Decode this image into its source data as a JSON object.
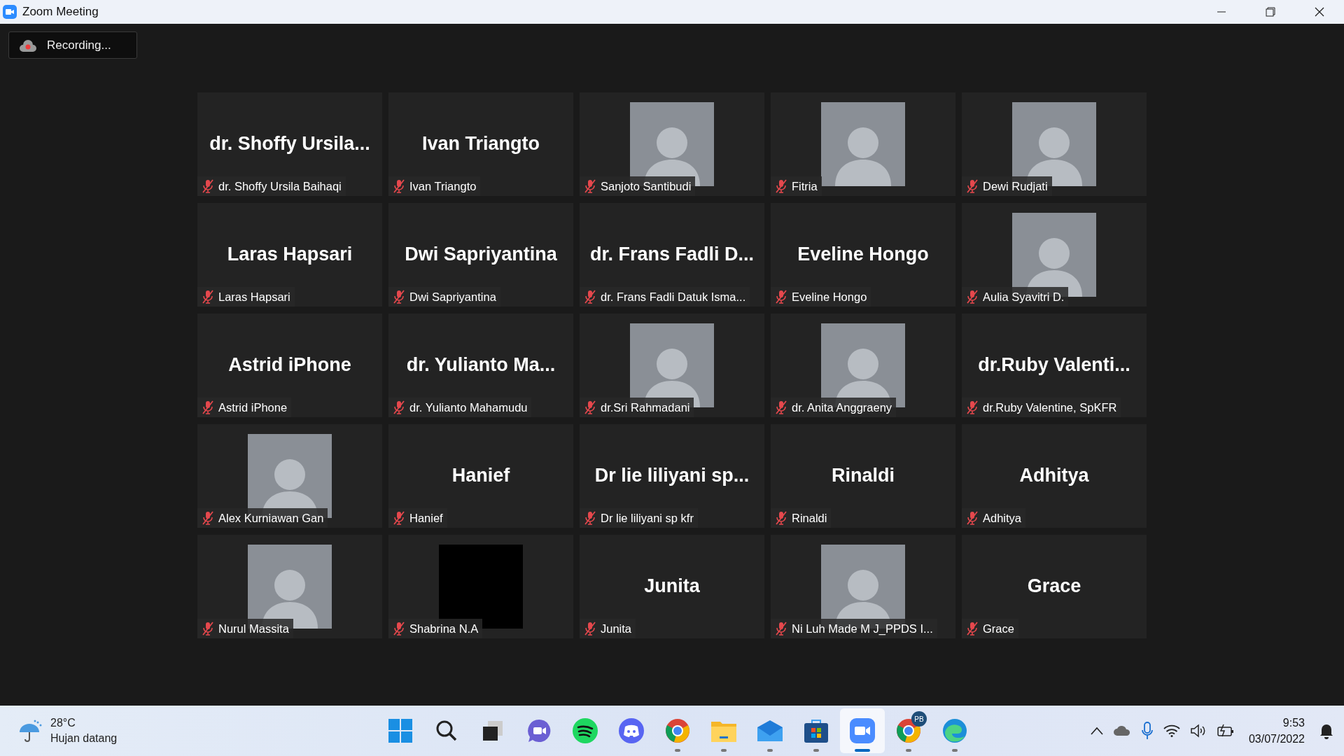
{
  "window": {
    "title": "Zoom Meeting"
  },
  "recording": {
    "label": "Recording..."
  },
  "tiles": [
    {
      "kind": "name",
      "display": "dr. Shoffy Ursila...",
      "name": "dr. Shoffy Ursila Baihaqi",
      "muted": true
    },
    {
      "kind": "name",
      "display": "Ivan Triangto",
      "name": "Ivan Triangto",
      "muted": true
    },
    {
      "kind": "photo",
      "name": "Sanjoto Santibudi",
      "muted": true
    },
    {
      "kind": "photo",
      "name": "Fitria",
      "muted": true
    },
    {
      "kind": "photo",
      "name": "Dewi Rudjati",
      "muted": true
    },
    {
      "kind": "name",
      "display": "Laras Hapsari",
      "name": "Laras Hapsari",
      "muted": true
    },
    {
      "kind": "name",
      "display": "Dwi Sapriyantina",
      "name": "Dwi Sapriyantina",
      "muted": true
    },
    {
      "kind": "name",
      "display": "dr. Frans Fadli D...",
      "name": "dr. Frans Fadli Datuk Isma...",
      "muted": true
    },
    {
      "kind": "name",
      "display": "Eveline Hongo",
      "name": "Eveline Hongo",
      "muted": true
    },
    {
      "kind": "photo",
      "name": "Aulia Syavitri D.",
      "muted": true
    },
    {
      "kind": "name",
      "display": "Astrid iPhone",
      "name": "Astrid iPhone",
      "muted": true
    },
    {
      "kind": "name",
      "display": "dr. Yulianto Ma...",
      "name": "dr. Yulianto Mahamudu",
      "muted": true
    },
    {
      "kind": "photo",
      "name": "dr.Sri Rahmadani",
      "muted": true
    },
    {
      "kind": "photo",
      "name": "dr. Anita Anggraeny",
      "muted": true
    },
    {
      "kind": "name",
      "display": "dr.Ruby  Valenti...",
      "name": "dr.Ruby Valentine, SpKFR",
      "muted": true
    },
    {
      "kind": "photo",
      "name": "Alex Kurniawan Gan",
      "muted": true
    },
    {
      "kind": "name",
      "display": "Hanief",
      "name": "Hanief",
      "muted": true
    },
    {
      "kind": "name",
      "display": "Dr lie liliyani sp...",
      "name": "Dr lie liliyani sp kfr",
      "muted": true
    },
    {
      "kind": "name",
      "display": "Rinaldi",
      "name": "Rinaldi",
      "muted": true
    },
    {
      "kind": "name",
      "display": "Adhitya",
      "name": "Adhitya",
      "muted": true
    },
    {
      "kind": "photo",
      "name": "Nurul Massita",
      "muted": true
    },
    {
      "kind": "blank",
      "name": "Shabrina N.A",
      "muted": true
    },
    {
      "kind": "name",
      "display": "Junita",
      "name": "Junita",
      "muted": true
    },
    {
      "kind": "photo",
      "name": "Ni Luh Made M J_PPDS I...",
      "muted": true
    },
    {
      "kind": "name",
      "display": "Grace",
      "name": "Grace",
      "muted": true
    }
  ],
  "taskbar": {
    "weather": {
      "temp": "28°C",
      "condition": "Hujan datang"
    },
    "apps": [
      {
        "kind": "start",
        "active": false
      },
      {
        "kind": "search",
        "active": false
      },
      {
        "kind": "taskview",
        "active": false
      },
      {
        "kind": "chat",
        "active": false
      },
      {
        "kind": "spotify",
        "active": false
      },
      {
        "kind": "discord",
        "active": false
      },
      {
        "kind": "chrome",
        "active": false
      },
      {
        "kind": "files",
        "active": false
      },
      {
        "kind": "mail",
        "active": false
      },
      {
        "kind": "store",
        "active": false
      },
      {
        "kind": "zoom",
        "active": true
      },
      {
        "kind": "chrome",
        "active": false,
        "badge": "PB"
      },
      {
        "kind": "edge",
        "active": false
      }
    ],
    "clock": {
      "time": "9:53",
      "date": "03/07/2022"
    }
  }
}
